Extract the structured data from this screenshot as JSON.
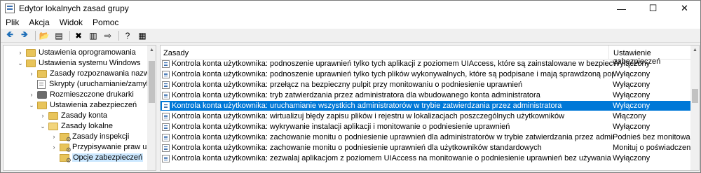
{
  "window": {
    "title": "Edytor lokalnych zasad grupy",
    "minimize": "—",
    "maximize": "☐",
    "close": "✕"
  },
  "menu": [
    "Plik",
    "Akcja",
    "Widok",
    "Pomoc"
  ],
  "toolbar": {
    "back": "🡸",
    "forward": "🡺",
    "up": "📂",
    "show_hide": "▤",
    "delete": "✖",
    "properties": "▥",
    "export": "⇨",
    "help": "?",
    "view": "▦"
  },
  "tree": {
    "items": [
      {
        "label": "Ustawienia oprogramowania",
        "expander": "›",
        "icon": "folder"
      },
      {
        "label": "Ustawienia systemu Windows",
        "expander": "⌄",
        "icon": "folder"
      },
      {
        "label": "Zasady rozpoznawania nazw",
        "expander": "›",
        "icon": "folder"
      },
      {
        "label": "Skrypty (uruchamianie/zamykanie)",
        "expander": "",
        "icon": "doc"
      },
      {
        "label": "Rozmieszczone drukarki",
        "expander": "›",
        "icon": "printer"
      },
      {
        "label": "Ustawienia zabezpieczeń",
        "expander": "⌄",
        "icon": "folder"
      },
      {
        "label": "Zasady konta",
        "expander": "›",
        "icon": "folder"
      },
      {
        "label": "Zasady lokalne",
        "expander": "⌄",
        "icon": "folder-open"
      },
      {
        "label": "Zasady inspekcji",
        "expander": "›",
        "icon": "gear-folder"
      },
      {
        "label": "Przypisywanie praw użytkowr",
        "expander": "›",
        "icon": "gear-folder"
      },
      {
        "label": "Opcje zabezpieczeń",
        "expander": "",
        "icon": "gear-folder",
        "selected": true
      }
    ]
  },
  "table": {
    "columns": [
      "Zasady",
      "Ustawienie zabezpieczeń"
    ],
    "rows": [
      {
        "policy": "Kontrola konta użytkownika: podnoszenie uprawnień tylko tych aplikacji z poziomem UIAccess, które są zainstalowane w bezpiecznych lokalizacjach",
        "setting": "Wyłączony"
      },
      {
        "policy": "Kontrola konta użytkownika: podnoszenie uprawnień tylko tych plików wykonywalnych, które są podpisane i mają sprawdzoną poprawność",
        "setting": "Wyłączony"
      },
      {
        "policy": "Kontrola konta użytkownika: przełącz na bezpieczny pulpit przy monitowaniu o podniesienie uprawnień",
        "setting": "Wyłączony"
      },
      {
        "policy": "Kontrola konta użytkownika: tryb zatwierdzania przez administratora dla wbudowanego konta administratora",
        "setting": "Wyłączony"
      },
      {
        "policy": "Kontrola konta użytkownika: uruchamianie wszystkich administratorów w trybie zatwierdzania przez administratora",
        "setting": "Wyłączony",
        "selected": true
      },
      {
        "policy": "Kontrola konta użytkownika: wirtualizuj błędy zapisu plików i rejestru w lokalizacjach poszczególnych użytkowników",
        "setting": "Włączony"
      },
      {
        "policy": "Kontrola konta użytkownika: wykrywanie instalacji aplikacji i monitowanie o podniesienie uprawnień",
        "setting": "Wyłączony"
      },
      {
        "policy": "Kontrola konta użytkownika: zachowanie monitu o podniesienie uprawnień dla administratorów w trybie zatwierdzania przez administratora",
        "setting": "Podnieś bez monitowania"
      },
      {
        "policy": "Kontrola konta użytkownika: zachowanie monitu o podniesienie uprawnień dla użytkowników standardowych",
        "setting": "Monituj o poświadczenia"
      },
      {
        "policy": "Kontrola konta użytkownika: zezwalaj aplikacjom z poziomem UIAccess na monitowanie o podniesienie uprawnień bez używania bezpiecznego pulpitu",
        "setting": "Wyłączony"
      }
    ]
  }
}
